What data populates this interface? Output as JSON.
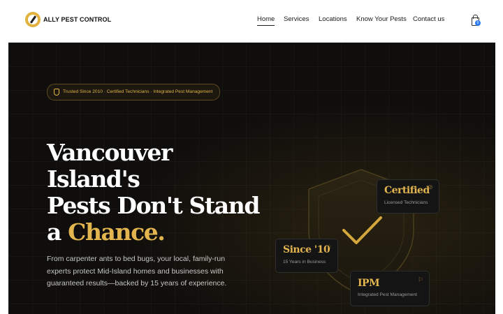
{
  "header": {
    "brand": "ALLY PEST CONTROL",
    "nav": [
      {
        "label": "Home",
        "active": true
      },
      {
        "label": "Services"
      },
      {
        "label": "Locations"
      },
      {
        "label": "Know Your Pests"
      },
      {
        "label": "Contact us"
      }
    ],
    "cart_count": "0",
    "cart_icon": "shopping-bag-icon"
  },
  "hero": {
    "badge_text": "Trusted Since 2010 · Certified Technicians · Integrated Pest Management",
    "title_lines": [
      "Vancouver",
      "Island's",
      "Pests Don't Stand"
    ],
    "title_last_prefix": "a ",
    "title_highlight": "Chance.",
    "description": "From carpenter ants to bed bugs, your local, family-run experts protect Mid-Island homes and businesses with guaranteed results—backed by 15 years of experience.",
    "accent_color": "#e3b54f",
    "cards": [
      {
        "title": "Certified",
        "subtitle": "Licensed Technicians",
        "icon": "check-circle-icon"
      },
      {
        "title": "Since '10",
        "subtitle": "15 Years in Business",
        "icon": "star-icon"
      },
      {
        "title": "IPM",
        "subtitle": "Integrated Pest Management",
        "icon": "flag-icon"
      }
    ]
  }
}
